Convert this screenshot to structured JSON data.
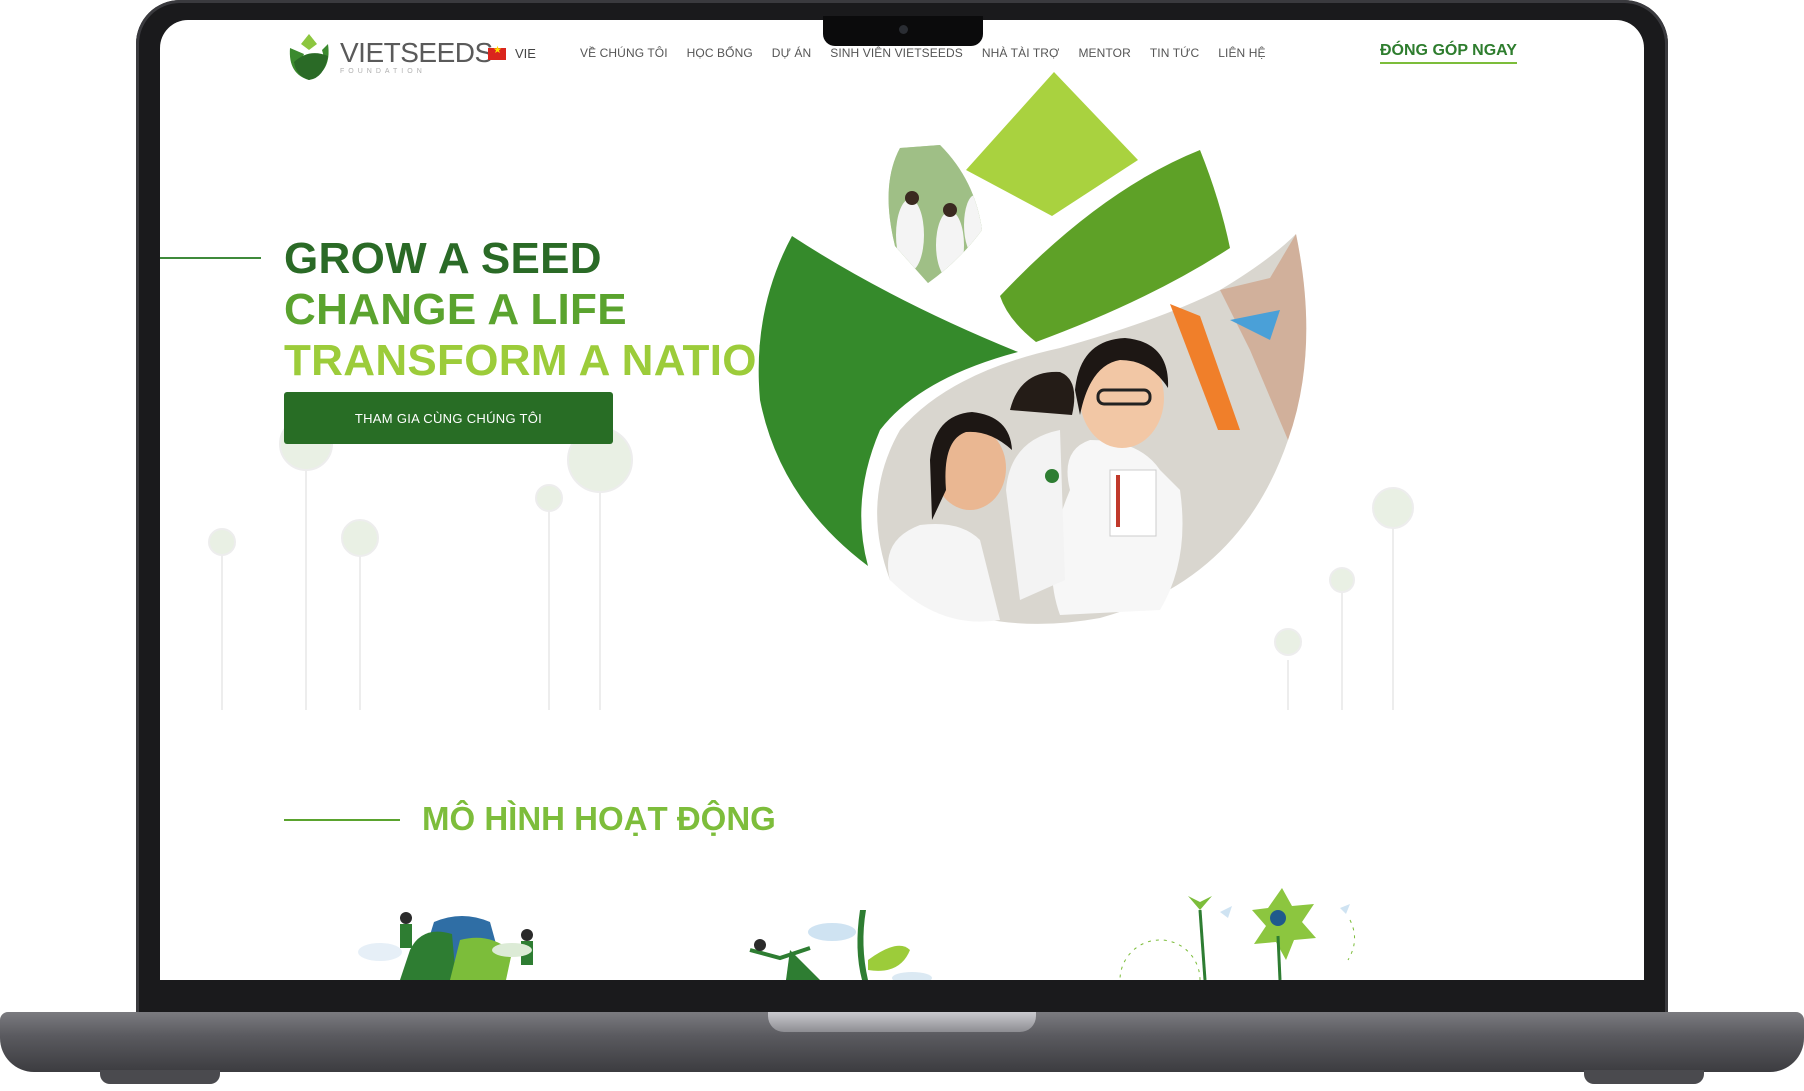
{
  "header": {
    "brand": "VIETSEEDS",
    "tagline": "FOUNDATION",
    "language": "VIE",
    "nav": [
      "VỀ CHÚNG TÔI",
      "HỌC BỔNG",
      "DỰ ÁN",
      "SINH VIÊN VIETSEEDS",
      "NHÀ TÀI TRỢ",
      "MENTOR",
      "TIN TỨC",
      "LIÊN HỆ"
    ],
    "donate": "ĐÓNG GÓP NGAY"
  },
  "hero": {
    "line1": "GROW A SEED",
    "line2": "CHANGE A LIFE",
    "line3": "TRANSFORM A NATION",
    "cta": "THAM GIA CÙNG CHÚNG TÔI"
  },
  "section": {
    "title": "MÔ HÌNH HOẠT ĐỘNG"
  },
  "colors": {
    "dark_green": "#2a6a26",
    "mid_green": "#5aa32e",
    "light_green": "#9ccc3a",
    "button_green": "#286d25"
  },
  "icons": [
    "vietseeds-logo-icon",
    "vietnam-flag-icon"
  ]
}
